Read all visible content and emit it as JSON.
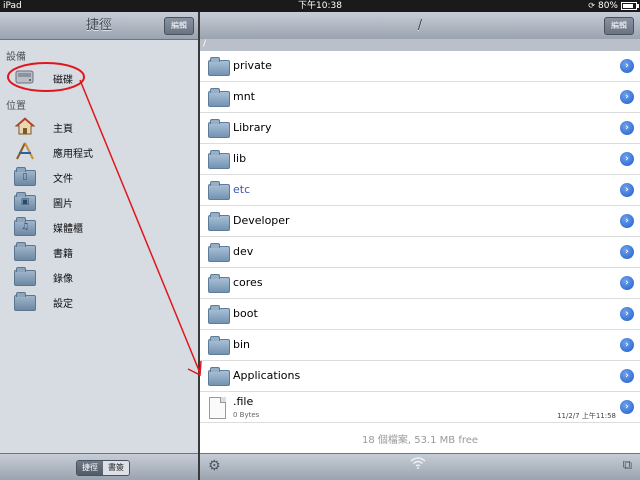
{
  "status": {
    "device": "iPad",
    "time": "下午10:38",
    "battery": "80%",
    "battery_level": 0.8
  },
  "left": {
    "title": "捷徑",
    "edit_label": "編輯",
    "sections": [
      {
        "header": "設備",
        "items": [
          {
            "label": "磁碟",
            "icon": "disk-icon"
          }
        ]
      },
      {
        "header": "位置",
        "items": [
          {
            "label": "主頁",
            "icon": "home-icon"
          },
          {
            "label": "應用程式",
            "icon": "applications-icon"
          },
          {
            "label": "文件",
            "icon": "documents-folder-icon"
          },
          {
            "label": "圖片",
            "icon": "pictures-folder-icon"
          },
          {
            "label": "媒體櫃",
            "icon": "media-folder-icon"
          },
          {
            "label": "書籍",
            "icon": "books-folder-icon"
          },
          {
            "label": "錄像",
            "icon": "videos-folder-icon"
          },
          {
            "label": "設定",
            "icon": "settings-folder-icon"
          }
        ]
      }
    ],
    "bottom_tabs": [
      "捷徑",
      "書簽"
    ]
  },
  "right": {
    "title": "/",
    "edit_label": "編輯",
    "path": "/",
    "items": [
      {
        "name": "private",
        "type": "folder"
      },
      {
        "name": "mnt",
        "type": "folder"
      },
      {
        "name": "Library",
        "type": "folder"
      },
      {
        "name": "lib",
        "type": "folder"
      },
      {
        "name": "etc",
        "type": "folder",
        "highlighted": true
      },
      {
        "name": "Developer",
        "type": "folder"
      },
      {
        "name": "dev",
        "type": "folder"
      },
      {
        "name": "cores",
        "type": "folder"
      },
      {
        "name": "boot",
        "type": "folder"
      },
      {
        "name": "bin",
        "type": "folder"
      },
      {
        "name": "Applications",
        "type": "folder"
      },
      {
        "name": ".file",
        "type": "file",
        "size": "0 Bytes",
        "date": "11/2/7 上午11:58"
      }
    ],
    "footer": "18 個檔案, 53.1 MB free"
  },
  "colors": {
    "annotation": "#e0161b",
    "link_blue": "#3a56b8",
    "disclosure": "#1f5cc9"
  }
}
